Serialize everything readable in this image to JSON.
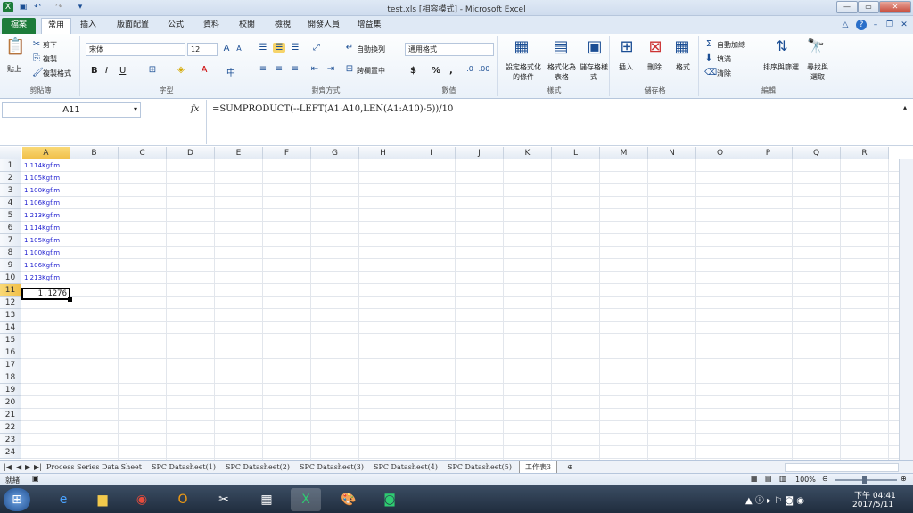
{
  "window": {
    "title": "test.xls  [相容模式] - Microsoft Excel"
  },
  "ribbon_tabs": [
    "檔案",
    "常用",
    "插入",
    "版面配置",
    "公式",
    "資料",
    "校閱",
    "檢視",
    "開發人員",
    "增益集"
  ],
  "clipboard": {
    "paste": "貼上",
    "cut": "剪下",
    "copy": "複製",
    "format_painter": "複製格式",
    "label": "剪貼簿"
  },
  "font": {
    "name": "宋体",
    "size": "12",
    "label": "字型",
    "bold": "B",
    "italic": "I",
    "underline": "U"
  },
  "alignment": {
    "wrap": "自動換列",
    "merge": "跨欄置中",
    "label": "對齊方式"
  },
  "number": {
    "format": "通用格式",
    "currency": "$",
    "percent": "%",
    "comma": ",",
    "label": "數值"
  },
  "styles": {
    "cond": "設定格式化的條件",
    "table": "格式化為表格",
    "cell": "儲存格樣式",
    "label": "樣式"
  },
  "cells": {
    "insert": "插入",
    "delete": "刪除",
    "format": "格式",
    "label": "儲存格"
  },
  "editing": {
    "autosum": "自動加總",
    "fill": "填滿",
    "clear": "清除",
    "sort": "排序與篩選",
    "find": "尋找與選取",
    "label": "編輯"
  },
  "formula_bar": {
    "name_box": "A11",
    "fx": "fx",
    "formula": "=SUMPRODUCT(--LEFT(A1:A10,LEN(A1:A10)-5))/10"
  },
  "columns": [
    "A",
    "B",
    "C",
    "D",
    "E",
    "F",
    "G",
    "H",
    "I",
    "J",
    "K",
    "L",
    "M",
    "N",
    "O",
    "P",
    "Q",
    "R"
  ],
  "rows": [
    "1",
    "2",
    "3",
    "4",
    "5",
    "6",
    "7",
    "8",
    "9",
    "10",
    "11",
    "12",
    "13",
    "14",
    "15",
    "16",
    "17",
    "18",
    "19",
    "20",
    "21",
    "22",
    "23",
    "24"
  ],
  "cells_a": [
    "1.114Kgf.m",
    "1.105Kgf.m",
    "1.100Kgf.m",
    "1.106Kgf.m",
    "1.213Kgf.m",
    "1.114Kgf.m",
    "1.105Kgf.m",
    "1.100Kgf.m",
    "1.106Kgf.m",
    "1.213Kgf.m"
  ],
  "result": "1.1276",
  "sheets": [
    "Process Series Data Sheet",
    "SPC Datasheet(1)",
    "SPC Datasheet(2)",
    "SPC Datasheet(3)",
    "SPC Datasheet(4)",
    "SPC Datasheet(5)",
    "工作表3"
  ],
  "status": {
    "ready": "就緒",
    "zoom": "100%"
  },
  "taskbar": {
    "time": "下午 04:41",
    "date": "2017/5/11"
  }
}
